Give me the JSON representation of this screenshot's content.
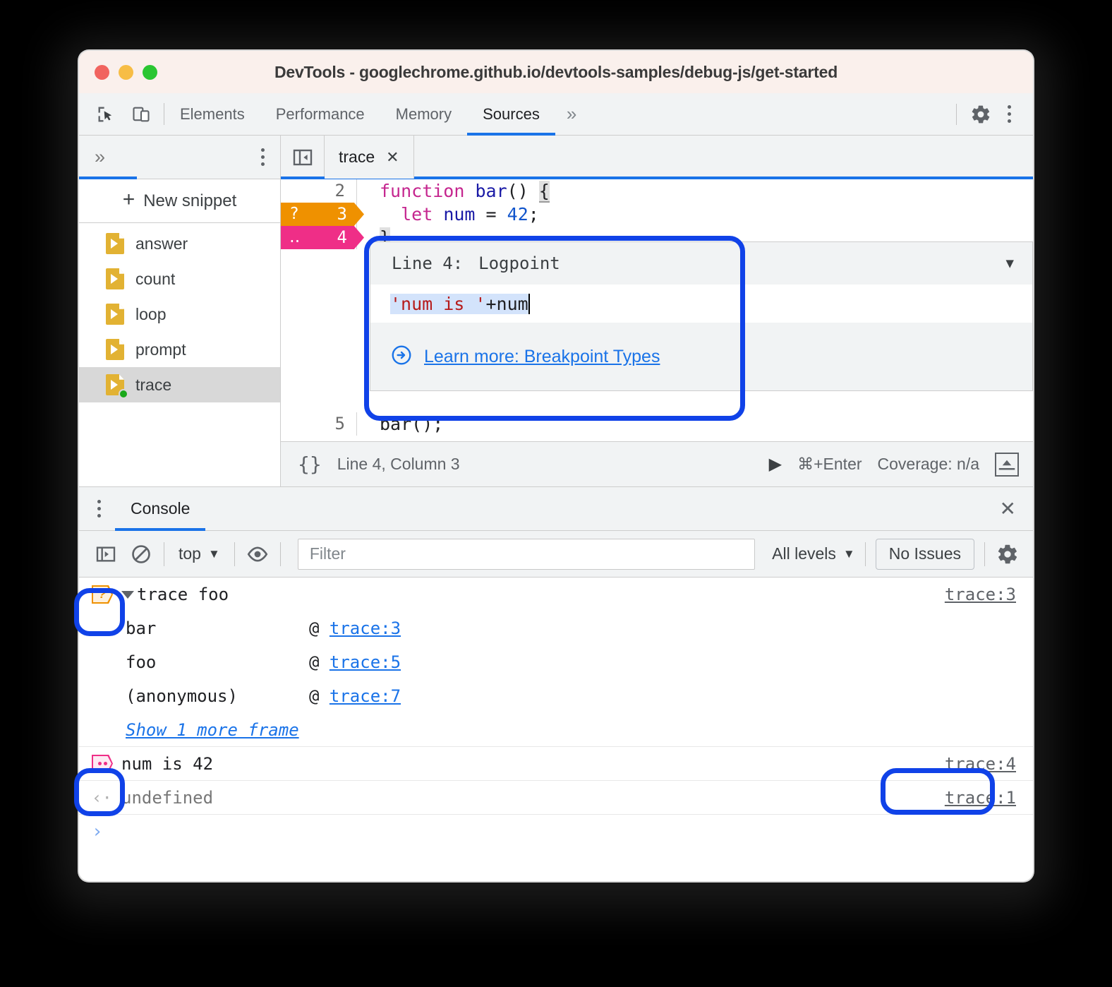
{
  "window": {
    "title": "DevTools - googlechrome.github.io/devtools-samples/debug-js/get-started",
    "traffic_lights": [
      "close",
      "minimize",
      "maximize"
    ]
  },
  "devtools_tabs": {
    "items": [
      {
        "label": "Elements",
        "active": false
      },
      {
        "label": "Performance",
        "active": false
      },
      {
        "label": "Memory",
        "active": false
      },
      {
        "label": "Sources",
        "active": true
      }
    ],
    "overflow": "»",
    "left_icons": [
      "inspect-icon",
      "device-toolbar-icon"
    ],
    "right_icons": [
      "settings-gear-icon",
      "more-options-kebab-icon"
    ]
  },
  "navigator": {
    "overflow": "»",
    "new_snippet_label": "New snippet",
    "snippets": [
      {
        "name": "answer",
        "selected": false,
        "has_status_dot": false
      },
      {
        "name": "count",
        "selected": false,
        "has_status_dot": false
      },
      {
        "name": "loop",
        "selected": false,
        "has_status_dot": false
      },
      {
        "name": "prompt",
        "selected": false,
        "has_status_dot": false
      },
      {
        "name": "trace",
        "selected": true,
        "has_status_dot": true
      }
    ]
  },
  "editor": {
    "open_tab": "trace",
    "close_glyph": "✕",
    "lines": [
      {
        "number": "2",
        "code": "function bar() {",
        "breakpoint": null
      },
      {
        "number": "3",
        "code": "  let num = 42;",
        "breakpoint": "conditional"
      },
      {
        "number": "4",
        "code": "}",
        "breakpoint": "logpoint"
      },
      {
        "number": "5",
        "code": "bar();",
        "breakpoint": null
      }
    ],
    "breakpoint_marks": {
      "conditional": "?",
      "logpoint": "‥"
    }
  },
  "logpoint_popup": {
    "line_label": "Line 4:",
    "type_label": "Logpoint",
    "caret_glyph": "▼",
    "expression_string": "'num is '",
    "expression_operator": " + ",
    "expression_variable": "num",
    "learn_more_label": "Learn more: Breakpoint Types",
    "learn_more_icon": "arrow-right-circle-icon"
  },
  "sources_status": {
    "format_icon": "{}",
    "position": "Line 4, Column 3",
    "run_icon": "▶",
    "run_shortcut": "⌘+Enter",
    "coverage": "Coverage: n/a",
    "drawer_toggle_icon": "show-drawer-icon"
  },
  "drawer": {
    "tab_label": "Console",
    "kebab_icon": "more-options-kebab-icon",
    "close_glyph": "✕"
  },
  "console_toolbar": {
    "sidebar_icon": "console-sidebar-icon",
    "clear_icon": "clear-console-icon",
    "context": "top",
    "eye_icon": "live-expression-eye-icon",
    "filter_placeholder": "Filter",
    "filter_value": "",
    "levels": "All levels",
    "issues_label": "No Issues",
    "settings_icon": "settings-gear-icon",
    "caret_glyph": "▼"
  },
  "console_messages": [
    {
      "badge": "conditional-breakpoint-badge",
      "collapsible": true,
      "text": "trace foo",
      "source": "trace:3",
      "frames": [
        {
          "name": "bar",
          "at": "@",
          "link": "trace:3"
        },
        {
          "name": "foo",
          "at": "@",
          "link": "trace:5"
        },
        {
          "name": "(anonymous)",
          "at": "@",
          "link": "trace:7"
        }
      ],
      "show_more": "Show 1 more frame"
    },
    {
      "badge": "logpoint-badge",
      "collapsible": false,
      "text": "num is 42",
      "source": "trace:4",
      "highlighted": true
    },
    {
      "badge": null,
      "collapsible": false,
      "arrow": "‹·",
      "text": "undefined",
      "source": "trace:1"
    }
  ],
  "console_prompt": {
    "caret": "›"
  },
  "annotations": [
    {
      "name": "logpoint-popup-highlight"
    },
    {
      "name": "conditional-badge-highlight"
    },
    {
      "name": "logpoint-badge-highlight"
    },
    {
      "name": "trace4-link-highlight"
    }
  ],
  "colors": {
    "accent": "#1a73e8",
    "annotation": "#1042e8",
    "conditional_breakpoint": "#ef9100",
    "logpoint": "#ef2e87",
    "snippet_icon": "#e2b233",
    "titlebar_bg": "#faf0ec"
  }
}
